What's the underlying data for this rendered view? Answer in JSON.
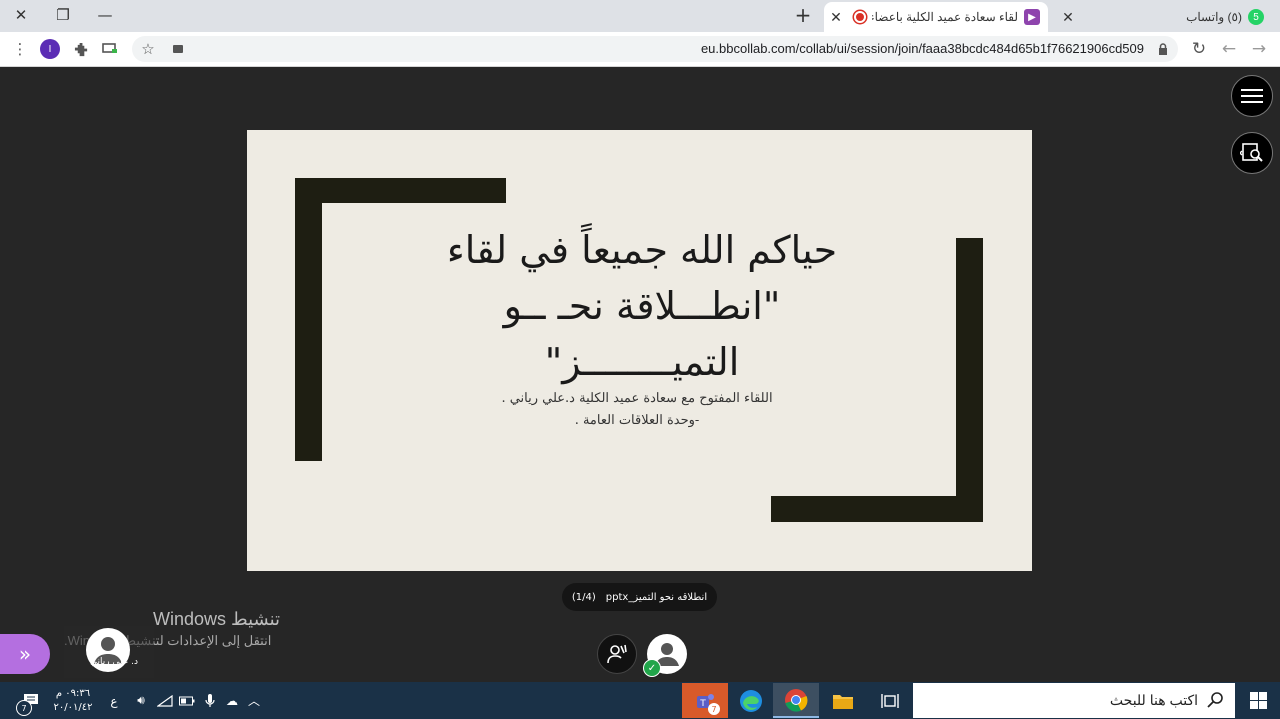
{
  "window": {
    "close_label": "✕",
    "restore_label": "❐",
    "minimize_label": "—"
  },
  "tabs": [
    {
      "title": "لقاء سعادة عميد الكلية باعضاء",
      "active": true
    },
    {
      "title": "(٥) واتساب",
      "active": false,
      "badge": "5"
    }
  ],
  "new_tab_label": "+",
  "toolbar": {
    "url": "eu.bbcollab.com/collab/ui/session/join/faaa38bcdc484d65b1f76621906cd509",
    "profile_initial": "I"
  },
  "slide": {
    "title_lines": [
      "حياكم الله جميعاً في لقاء",
      "\"انطـــلاقة نحـ ــو",
      "التميــــــــز\""
    ],
    "subtitle_lines": [
      "اللقاء المفتوح مع سعادة عميد الكلية د.علي رياني .",
      "-وحدة العلاقات العامة ."
    ]
  },
  "file_pill": {
    "filename": "انطلاقه نحو التميز_pptx",
    "page": "(1/4)"
  },
  "presenter": {
    "name": "د. علي رياني"
  },
  "watermark": {
    "title": "تنشيط Windows",
    "subtitle": "انتقل إلى الإعدادات لتنشيط Windows."
  },
  "taskbar": {
    "search_placeholder": "اكتب هنا للبحث",
    "time": "٠٩:٣٦ م",
    "date": "٢٠/٠١/٤٢",
    "lang": "ع",
    "notif_count": "7"
  },
  "colors": {
    "slide_bg": "#eeebe3",
    "slide_bar": "#1e1e12",
    "stage_bg": "#262626",
    "panel_btn": "#b46fe0",
    "taskbar": "#1a3147"
  }
}
